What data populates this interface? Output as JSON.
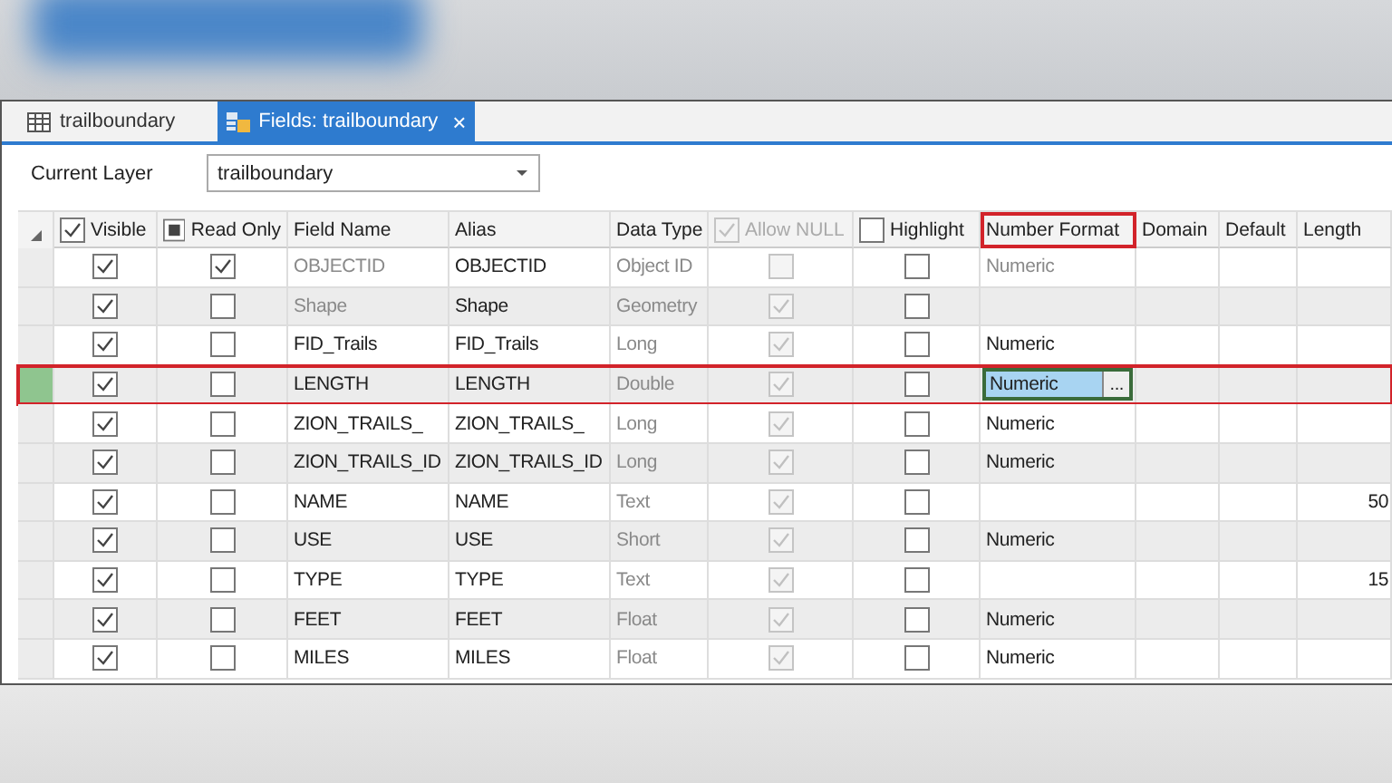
{
  "tabs": [
    {
      "label": "trailboundary",
      "selected": false,
      "closable": false
    },
    {
      "label": "Fields: trailboundary",
      "selected": true,
      "closable": true
    }
  ],
  "close_glyph": "×",
  "current_layer": {
    "label": "Current Layer",
    "value": "trailboundary"
  },
  "columns": [
    {
      "label": "Visible",
      "kind": "checkbox",
      "checked": true,
      "mixed": false,
      "disabled": false,
      "outlined": false
    },
    {
      "label": "Read Only",
      "kind": "checkbox",
      "checked": false,
      "mixed": true,
      "disabled": false,
      "outlined": false
    },
    {
      "label": "Field Name",
      "kind": "plain",
      "outlined": false
    },
    {
      "label": "Alias",
      "kind": "plain",
      "outlined": false
    },
    {
      "label": "Data Type",
      "kind": "plain",
      "outlined": false
    },
    {
      "label": "Allow NULL",
      "kind": "checkbox",
      "checked": true,
      "mixed": false,
      "disabled": true,
      "outlined": false
    },
    {
      "label": "Highlight",
      "kind": "checkbox",
      "checked": false,
      "mixed": false,
      "disabled": false,
      "outlined": false
    },
    {
      "label": "Number Format",
      "kind": "plain",
      "outlined": true
    },
    {
      "label": "Domain",
      "kind": "plain",
      "outlined": false
    },
    {
      "label": "Default",
      "kind": "plain",
      "outlined": false
    },
    {
      "label": "Length",
      "kind": "plain",
      "outlined": false
    }
  ],
  "editor_button": "...",
  "rows": [
    {
      "selected": false,
      "disabled": true,
      "visible": true,
      "read_only": true,
      "field_name": "OBJECTID",
      "alias": "OBJECTID",
      "data_type": "Object ID",
      "allow_null": false,
      "highlight": false,
      "number_format": "Numeric",
      "editing": false,
      "length": ""
    },
    {
      "selected": false,
      "disabled": true,
      "visible": true,
      "read_only": false,
      "field_name": "Shape",
      "alias": "Shape",
      "data_type": "Geometry",
      "allow_null": true,
      "highlight": false,
      "number_format": "",
      "editing": false,
      "length": ""
    },
    {
      "selected": false,
      "disabled": false,
      "visible": true,
      "read_only": false,
      "field_name": "FID_Trails",
      "alias": "FID_Trails",
      "data_type": "Long",
      "allow_null": true,
      "highlight": false,
      "number_format": "Numeric",
      "editing": false,
      "length": ""
    },
    {
      "selected": true,
      "disabled": false,
      "visible": true,
      "read_only": false,
      "field_name": "LENGTH",
      "alias": "LENGTH",
      "data_type": "Double",
      "allow_null": true,
      "highlight": false,
      "number_format": "Numeric",
      "editing": true,
      "length": ""
    },
    {
      "selected": false,
      "disabled": false,
      "visible": true,
      "read_only": false,
      "field_name": "ZION_TRAILS_",
      "alias": "ZION_TRAILS_",
      "data_type": "Long",
      "allow_null": true,
      "highlight": false,
      "number_format": "Numeric",
      "editing": false,
      "length": ""
    },
    {
      "selected": false,
      "disabled": false,
      "visible": true,
      "read_only": false,
      "field_name": "ZION_TRAILS_ID",
      "alias": "ZION_TRAILS_ID",
      "data_type": "Long",
      "allow_null": true,
      "highlight": false,
      "number_format": "Numeric",
      "editing": false,
      "length": ""
    },
    {
      "selected": false,
      "disabled": false,
      "visible": true,
      "read_only": false,
      "field_name": "NAME",
      "alias": "NAME",
      "data_type": "Text",
      "allow_null": true,
      "highlight": false,
      "number_format": "",
      "editing": false,
      "length": "50"
    },
    {
      "selected": false,
      "disabled": false,
      "visible": true,
      "read_only": false,
      "field_name": "USE",
      "alias": "USE",
      "data_type": "Short",
      "allow_null": true,
      "highlight": false,
      "number_format": "Numeric",
      "editing": false,
      "length": ""
    },
    {
      "selected": false,
      "disabled": false,
      "visible": true,
      "read_only": false,
      "field_name": "TYPE",
      "alias": "TYPE",
      "data_type": "Text",
      "allow_null": true,
      "highlight": false,
      "number_format": "",
      "editing": false,
      "length": "15"
    },
    {
      "selected": false,
      "disabled": false,
      "visible": true,
      "read_only": false,
      "field_name": "FEET",
      "alias": "FEET",
      "data_type": "Float",
      "allow_null": true,
      "highlight": false,
      "number_format": "Numeric",
      "editing": false,
      "length": ""
    },
    {
      "selected": false,
      "disabled": false,
      "visible": true,
      "read_only": false,
      "field_name": "MILES",
      "alias": "MILES",
      "data_type": "Float",
      "allow_null": true,
      "highlight": false,
      "number_format": "Numeric",
      "editing": false,
      "length": ""
    }
  ]
}
